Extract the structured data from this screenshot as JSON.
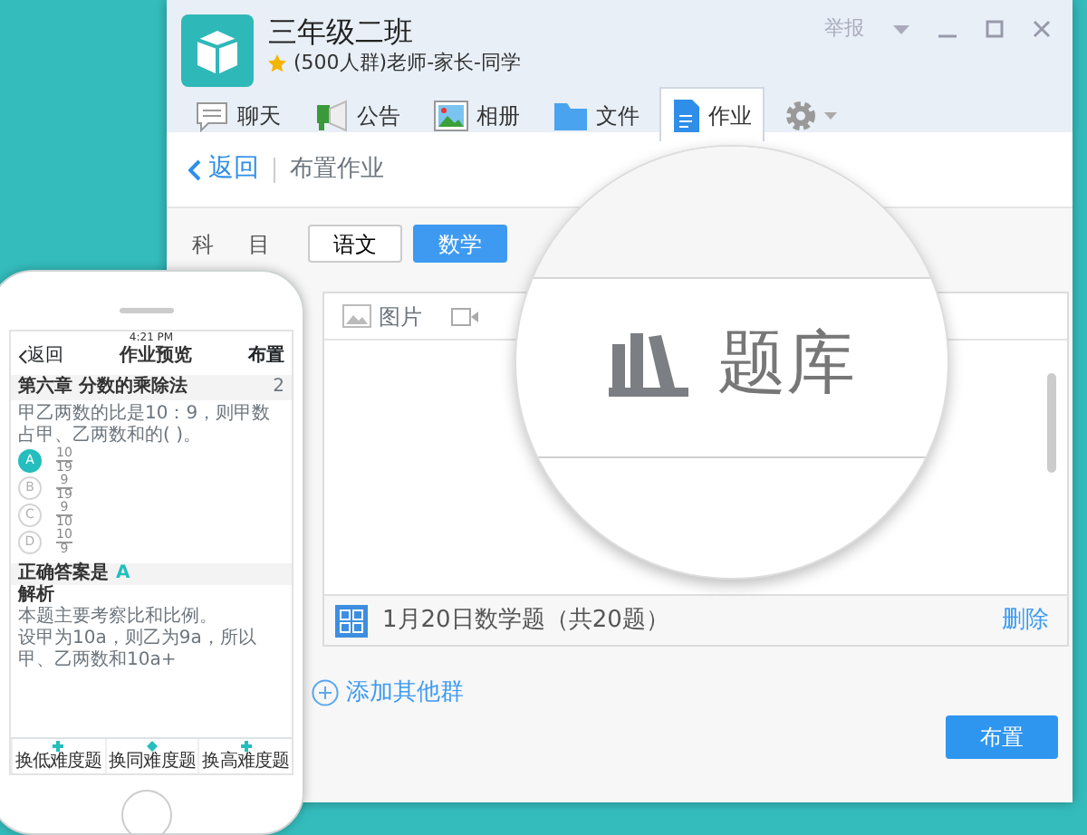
{
  "window": {
    "title": "三年级二班",
    "starred": true,
    "subtitle": "(500人群)老师-家长-同学",
    "report": "举报"
  },
  "tabs": [
    {
      "label": "聊天",
      "selected": false
    },
    {
      "label": "公告",
      "selected": false
    },
    {
      "label": "相册",
      "selected": false
    },
    {
      "label": "文件",
      "selected": false
    },
    {
      "label": "作业",
      "selected": true
    }
  ],
  "breadcrumb": {
    "back": "返回",
    "title": "布置作业"
  },
  "subject_label": "科目",
  "subjects": [
    {
      "label": "语文",
      "selected": false
    },
    {
      "label": "数学",
      "selected": true
    }
  ],
  "editor": {
    "tools": [
      {
        "kind": "image",
        "label": "图片"
      },
      {
        "kind": "video"
      }
    ],
    "attachment": {
      "title": "1月20日数学题（共20题）",
      "action": "删除"
    }
  },
  "add_group": "添加其他群",
  "submit": "布置",
  "magnifier": {
    "label": "题库"
  },
  "phone": {
    "time": "4:21 PM",
    "back": "返回",
    "title": "作业预览",
    "action": "布置",
    "chapter": "第六章 分数的乘除法",
    "counter": "2",
    "question": "甲乙两数的比是10：9，则甲数占甲、乙两数和的( )。",
    "options": [
      {
        "letter": "A",
        "numerator": "10",
        "denominator": "19",
        "selected": true
      },
      {
        "letter": "B",
        "numerator": "9",
        "denominator": "19",
        "selected": false
      },
      {
        "letter": "C",
        "numerator": "9",
        "denominator": "10",
        "selected": false
      },
      {
        "letter": "D",
        "numerator": "10",
        "denominator": "9",
        "selected": false
      }
    ],
    "answer_label": "正确答案是",
    "answer": "A",
    "analysis_title": "解析",
    "analysis": [
      "本题主要考察比和比例。",
      "设甲为10a，则乙为9a，所以甲、乙两数和10a+"
    ],
    "buttons": [
      {
        "label": "换低难度题",
        "kind": "down"
      },
      {
        "label": "换同难度题",
        "kind": "same"
      },
      {
        "label": "换高难度题",
        "kind": "up"
      }
    ]
  }
}
